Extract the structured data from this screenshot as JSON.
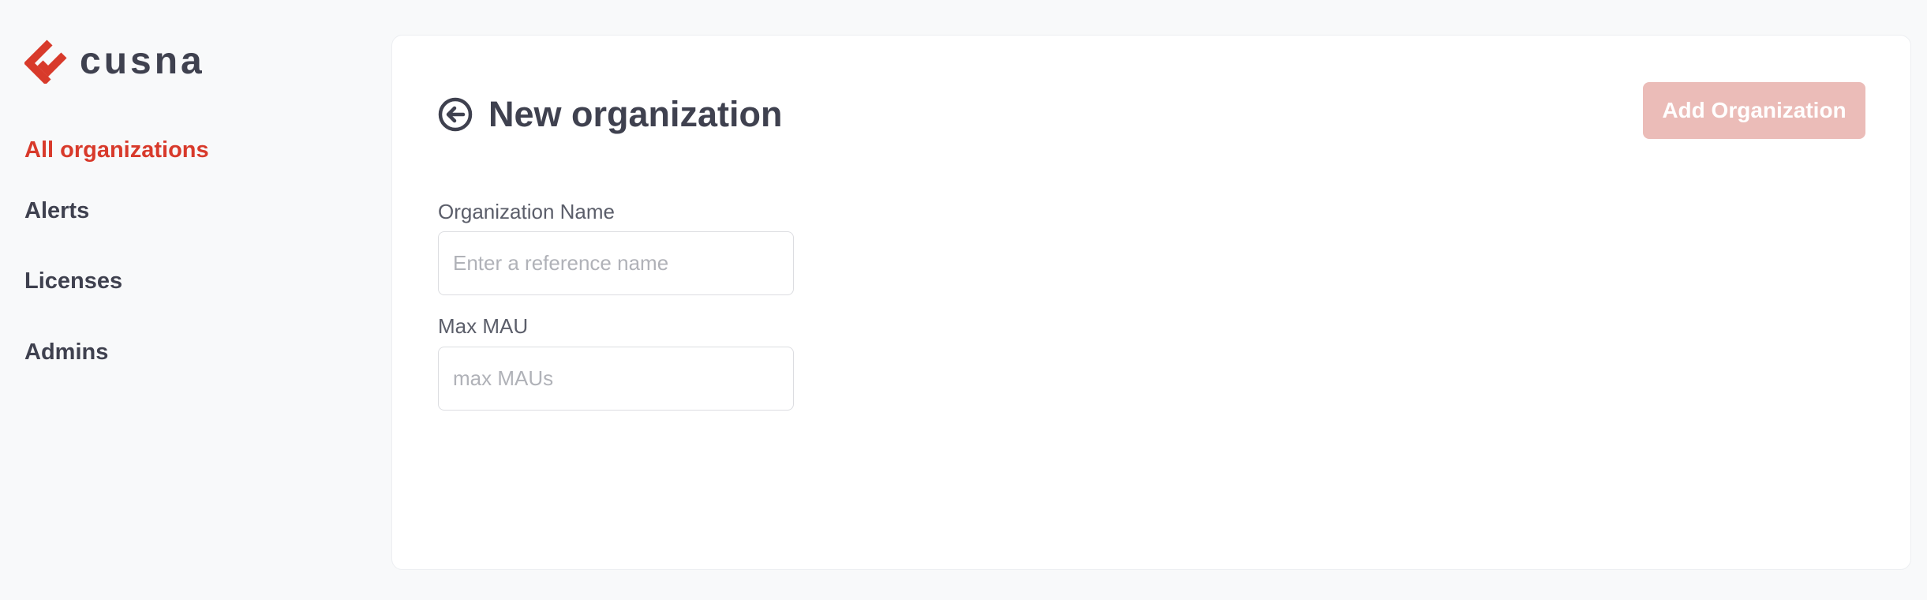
{
  "brand": {
    "name": "cusna",
    "accent_color": "#d83a2b",
    "logo_icon": "cusna-chevron-logo"
  },
  "sidebar": {
    "items": [
      {
        "label": "All organizations",
        "active": true
      },
      {
        "label": "Alerts",
        "active": false
      },
      {
        "label": "Licenses",
        "active": false
      },
      {
        "label": "Admins",
        "active": false
      }
    ]
  },
  "page": {
    "title": "New organization",
    "back_icon": "arrow-left-circle-icon",
    "primary_button": {
      "label": "Add Organization",
      "disabled": true,
      "color": "#ebbcb8"
    }
  },
  "form": {
    "org_name": {
      "label": "Organization Name",
      "value": "",
      "placeholder": "Enter a reference name"
    },
    "max_mau": {
      "label": "Max MAU",
      "value": "",
      "placeholder": "max MAUs"
    }
  }
}
